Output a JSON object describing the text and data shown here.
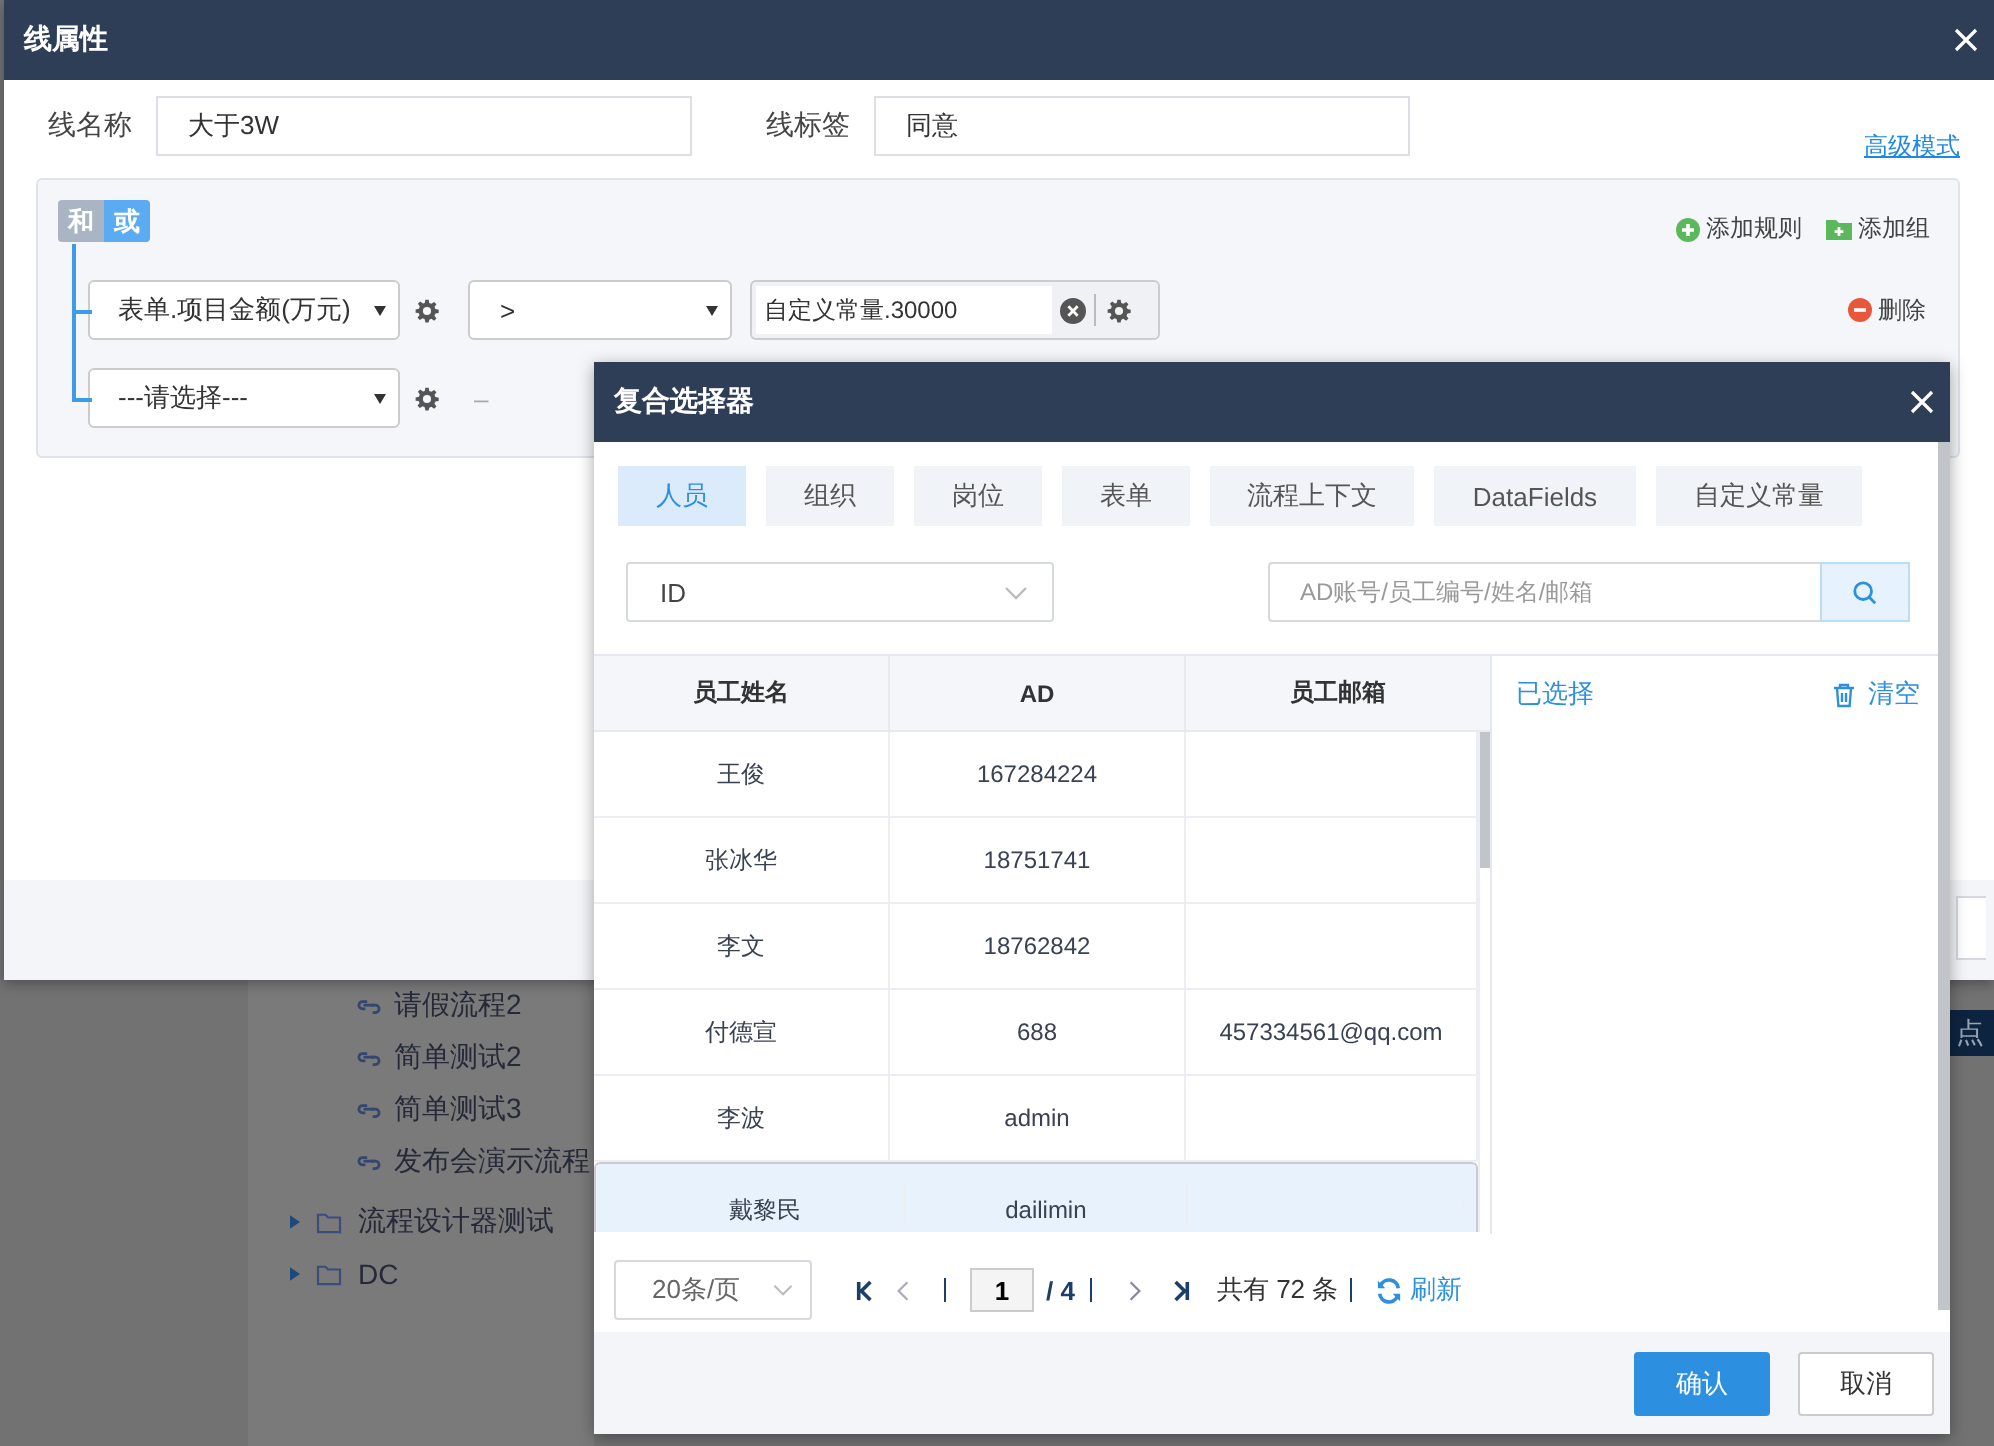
{
  "background_tree": {
    "items": [
      {
        "label": "请假流程2",
        "kind": "flow"
      },
      {
        "label": "简单测试2",
        "kind": "flow"
      },
      {
        "label": "简单测试3",
        "kind": "flow"
      },
      {
        "label": "发布会演示流程",
        "kind": "flow"
      },
      {
        "label": "流程设计器测试",
        "kind": "folder"
      },
      {
        "label": "DC",
        "kind": "folder"
      }
    ]
  },
  "background_tag": "点",
  "dialog": {
    "title": "线属性",
    "line_name": {
      "label": "线名称",
      "value": "大于3W"
    },
    "line_tag": {
      "label": "线标签",
      "value": "同意"
    },
    "advanced_link": "高级模式",
    "rule_group": {
      "conditions": [
        {
          "label": "和",
          "selected": false
        },
        {
          "label": "或",
          "selected": true
        }
      ],
      "add_rule": "添加规则",
      "add_group": "添加组",
      "rules": [
        {
          "kind": "complete",
          "field": "表单.项目金额(万元)",
          "operator": ">",
          "value": "自定义常量.30000",
          "delete": "删除"
        },
        {
          "kind": "empty",
          "field": "---请选择---",
          "placeholder": "–"
        }
      ]
    }
  },
  "selector": {
    "title": "复合选择器",
    "tabs": [
      {
        "label": "人员",
        "selected": true
      },
      {
        "label": "组织",
        "selected": false
      },
      {
        "label": "岗位",
        "selected": false
      },
      {
        "label": "表单",
        "selected": false
      },
      {
        "label": "流程上下文",
        "selected": false
      },
      {
        "label": "DataFields",
        "selected": false
      },
      {
        "label": "自定义常量",
        "selected": false
      }
    ],
    "filter_select": "ID",
    "search": {
      "placeholder": "AD账号/员工编号/姓名/邮箱"
    },
    "table": {
      "columns": [
        "员工姓名",
        "AD",
        "员工邮箱"
      ],
      "rows": [
        {
          "cells": [
            "王俊",
            "167284224",
            ""
          ],
          "selected": false
        },
        {
          "cells": [
            "张冰华",
            "18751741",
            ""
          ],
          "selected": false
        },
        {
          "cells": [
            "李文",
            "18762842",
            ""
          ],
          "selected": false
        },
        {
          "cells": [
            "付德宣",
            "688",
            "457334561@qq.com"
          ],
          "selected": false
        },
        {
          "cells": [
            "李波",
            "admin",
            ""
          ],
          "selected": false
        },
        {
          "cells": [
            "戴黎民",
            "dailimin",
            ""
          ],
          "selected": true
        }
      ]
    },
    "selected_panel": {
      "title": "已选择",
      "clear": "清空"
    },
    "pagination": {
      "page_size": "20条/页",
      "page": "1",
      "total_pages": "/ 4",
      "total": "共有 72 条",
      "refresh": "刷新"
    },
    "buttons": [
      {
        "label": "确认",
        "kind": "primary"
      },
      {
        "label": "取消",
        "kind": "secondary"
      }
    ]
  }
}
